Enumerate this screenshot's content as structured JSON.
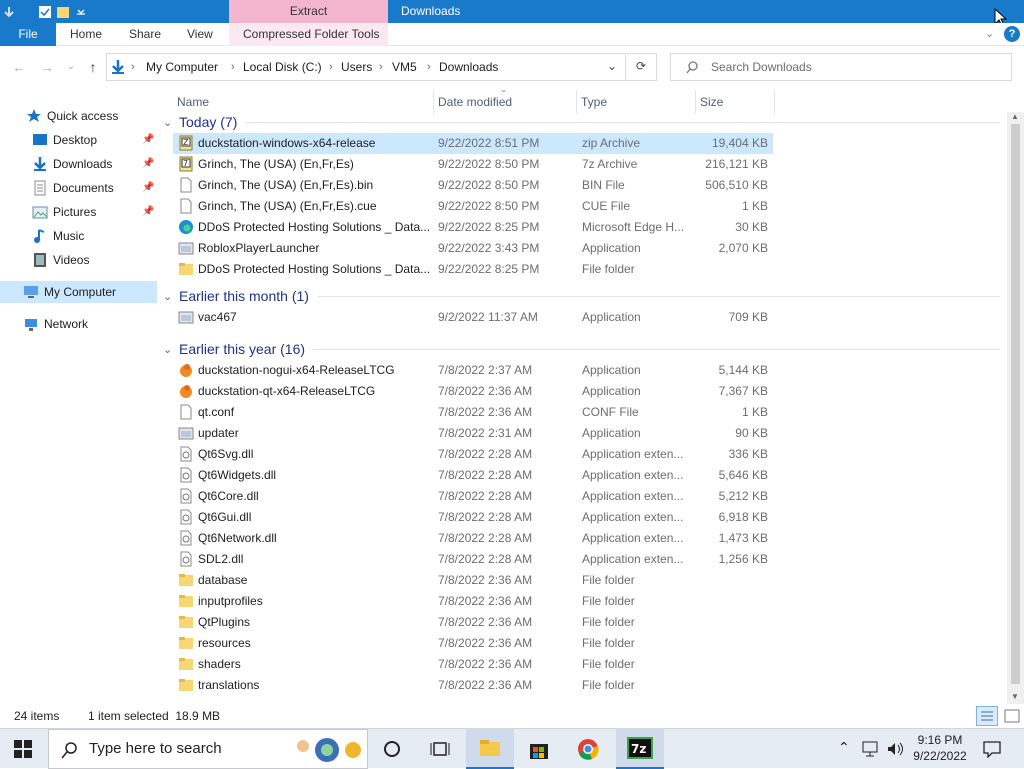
{
  "window": {
    "title": "Downloads",
    "context_tab_group": "Extract"
  },
  "ribbon": {
    "file": "File",
    "home": "Home",
    "share": "Share",
    "view": "View",
    "compressed": "Compressed Folder Tools"
  },
  "address": {
    "crumbs": [
      "My Computer",
      "Local Disk (C:)",
      "Users",
      "VM5",
      "Downloads"
    ]
  },
  "search": {
    "placeholder": "Search Downloads"
  },
  "nav": {
    "quick_access": "Quick access",
    "items": [
      {
        "label": "Desktop",
        "pinned": true
      },
      {
        "label": "Downloads",
        "pinned": true
      },
      {
        "label": "Documents",
        "pinned": true
      },
      {
        "label": "Pictures",
        "pinned": true
      },
      {
        "label": "Music",
        "pinned": false
      },
      {
        "label": "Videos",
        "pinned": false
      }
    ],
    "my_computer": "My Computer",
    "network": "Network"
  },
  "columns": {
    "name": "Name",
    "date": "Date modified",
    "type": "Type",
    "size": "Size"
  },
  "groups": [
    {
      "label": "Today (7)",
      "rows": [
        {
          "name": "duckstation-windows-x64-release",
          "date": "9/22/2022 8:51 PM",
          "type": "zip Archive",
          "size": "19,404 KB",
          "icon": "zip-icon",
          "selected": true
        },
        {
          "name": "Grinch, The (USA) (En,Fr,Es)",
          "date": "9/22/2022 8:50 PM",
          "type": "7z Archive",
          "size": "216,121 KB",
          "icon": "archive-icon"
        },
        {
          "name": "Grinch, The (USA) (En,Fr,Es).bin",
          "date": "9/22/2022 8:50 PM",
          "type": "BIN File",
          "size": "506,510 KB",
          "icon": "file-icon"
        },
        {
          "name": "Grinch, The (USA) (En,Fr,Es).cue",
          "date": "9/22/2022 8:50 PM",
          "type": "CUE File",
          "size": "1 KB",
          "icon": "file-icon"
        },
        {
          "name": "DDoS Protected Hosting Solutions _ Data...",
          "date": "9/22/2022 8:25 PM",
          "type": "Microsoft Edge H...",
          "size": "30 KB",
          "icon": "edge-icon"
        },
        {
          "name": "RobloxPlayerLauncher",
          "date": "9/22/2022 3:43 PM",
          "type": "Application",
          "size": "2,070 KB",
          "icon": "app-icon"
        },
        {
          "name": "DDoS Protected Hosting Solutions _ Data...",
          "date": "9/22/2022 8:25 PM",
          "type": "File folder",
          "size": "",
          "icon": "folder-icon"
        }
      ]
    },
    {
      "label": "Earlier this month (1)",
      "rows": [
        {
          "name": "vac467",
          "date": "9/2/2022 11:37 AM",
          "type": "Application",
          "size": "709 KB",
          "icon": "app-icon"
        }
      ]
    },
    {
      "label": "Earlier this year (16)",
      "rows": [
        {
          "name": "duckstation-nogui-x64-ReleaseLTCG",
          "date": "7/8/2022 2:37 AM",
          "type": "Application",
          "size": "5,144 KB",
          "icon": "duck-icon"
        },
        {
          "name": "duckstation-qt-x64-ReleaseLTCG",
          "date": "7/8/2022 2:36 AM",
          "type": "Application",
          "size": "7,367 KB",
          "icon": "duck-icon"
        },
        {
          "name": "qt.conf",
          "date": "7/8/2022 2:36 AM",
          "type": "CONF File",
          "size": "1 KB",
          "icon": "file-icon"
        },
        {
          "name": "updater",
          "date": "7/8/2022 2:31 AM",
          "type": "Application",
          "size": "90 KB",
          "icon": "app-icon"
        },
        {
          "name": "Qt6Svg.dll",
          "date": "7/8/2022 2:28 AM",
          "type": "Application exten...",
          "size": "336 KB",
          "icon": "dll-icon"
        },
        {
          "name": "Qt6Widgets.dll",
          "date": "7/8/2022 2:28 AM",
          "type": "Application exten...",
          "size": "5,646 KB",
          "icon": "dll-icon"
        },
        {
          "name": "Qt6Core.dll",
          "date": "7/8/2022 2:28 AM",
          "type": "Application exten...",
          "size": "5,212 KB",
          "icon": "dll-icon"
        },
        {
          "name": "Qt6Gui.dll",
          "date": "7/8/2022 2:28 AM",
          "type": "Application exten...",
          "size": "6,918 KB",
          "icon": "dll-icon"
        },
        {
          "name": "Qt6Network.dll",
          "date": "7/8/2022 2:28 AM",
          "type": "Application exten...",
          "size": "1,473 KB",
          "icon": "dll-icon"
        },
        {
          "name": "SDL2.dll",
          "date": "7/8/2022 2:28 AM",
          "type": "Application exten...",
          "size": "1,256 KB",
          "icon": "dll-icon"
        },
        {
          "name": "database",
          "date": "7/8/2022 2:36 AM",
          "type": "File folder",
          "size": "",
          "icon": "folder-icon"
        },
        {
          "name": "inputprofiles",
          "date": "7/8/2022 2:36 AM",
          "type": "File folder",
          "size": "",
          "icon": "folder-icon"
        },
        {
          "name": "QtPlugins",
          "date": "7/8/2022 2:36 AM",
          "type": "File folder",
          "size": "",
          "icon": "folder-icon"
        },
        {
          "name": "resources",
          "date": "7/8/2022 2:36 AM",
          "type": "File folder",
          "size": "",
          "icon": "folder-icon"
        },
        {
          "name": "shaders",
          "date": "7/8/2022 2:36 AM",
          "type": "File folder",
          "size": "",
          "icon": "folder-icon"
        },
        {
          "name": "translations",
          "date": "7/8/2022 2:36 AM",
          "type": "File folder",
          "size": "",
          "icon": "folder-icon"
        }
      ]
    }
  ],
  "status": {
    "count": "24 items",
    "selection": "1 item selected  18.9 MB"
  },
  "taskbar": {
    "search_placeholder": "Type here to search",
    "time": "9:16 PM",
    "date": "9/22/2022"
  },
  "colors": {
    "accent": "#1979ca",
    "selection": "#cce8ff",
    "context_tab": "#f4b6cf"
  }
}
